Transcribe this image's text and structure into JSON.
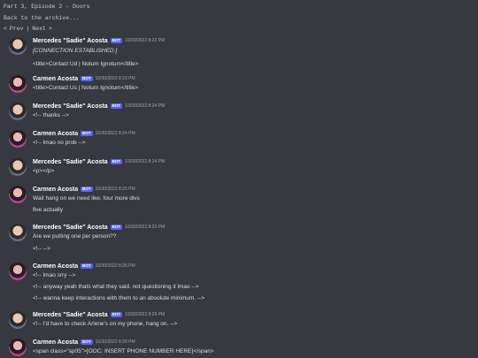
{
  "header": {
    "title": "Part 3, Episode 2 - Doors",
    "back_link": "Back to the archive...",
    "nav": {
      "open": "<",
      "prev": "Prev",
      "sep": "|",
      "next": "Next",
      "close": ">"
    }
  },
  "messages": [
    {
      "author": "Mercedes \"Sadie\" Acosta",
      "bot": "BOT",
      "time": "10/30/2022 8:22 PM",
      "lines": [
        "[CONNECTION ESTABLISHED.]",
        "<title>Contact Ud | Notum Ignotum</title>"
      ]
    },
    {
      "author": "Carmen Acosta",
      "bot": "BOT",
      "time": "10/30/2022 8:23 PM",
      "lines": [
        "<title>Contact Us | Notum Ignotum</title>"
      ]
    },
    {
      "author": "Mercedes \"Sadie\" Acosta",
      "bot": "BOT",
      "time": "10/30/2022 8:24 PM",
      "lines": [
        "<!-- thanks -->"
      ]
    },
    {
      "author": "Carmen Acosta",
      "bot": "BOT",
      "time": "10/30/2022 8:24 PM",
      "lines": [
        "<!-- lmao no prob -->"
      ]
    },
    {
      "author": "Mercedes \"Sadie\" Acosta",
      "bot": "BOT",
      "time": "10/30/2022 8:24 PM",
      "lines": [
        "<p></p>"
      ]
    },
    {
      "author": "Carmen Acosta",
      "bot": "BOT",
      "time": "10/30/2022 8:25 PM",
      "lines": [
        "Wait hang on we need like. four more divs",
        "five actually"
      ]
    },
    {
      "author": "Mercedes \"Sadie\" Acosta",
      "bot": "BOT",
      "time": "10/30/2022 8:25 PM",
      "lines": [
        "Are we putting one per person??",
        "<!-- -->"
      ]
    },
    {
      "author": "Carmen Acosta",
      "bot": "BOT",
      "time": "10/30/2022 8:26 PM",
      "lines": [
        "<!-- lmao srry -->",
        "<!-- anyway yeah thats what they said. not questioning it lmao -->",
        "<!-- wanna keep interactions with them to an absolute minimum. -->"
      ]
    },
    {
      "author": "Mercedes \"Sadie\" Acosta",
      "bot": "BOT",
      "time": "10/30/2022 8:28 PM",
      "lines": [
        "<!-- I'd have to check Arlene's on my phone, hang on. -->"
      ]
    },
    {
      "author": "Carmen Acosta",
      "bot": "BOT",
      "time": "10/30/2022 8:28 PM",
      "lines": [
        "<span class=\"sp05\">[OOC: INSERT PHONE NUMBER HERE]</span>"
      ]
    }
  ]
}
